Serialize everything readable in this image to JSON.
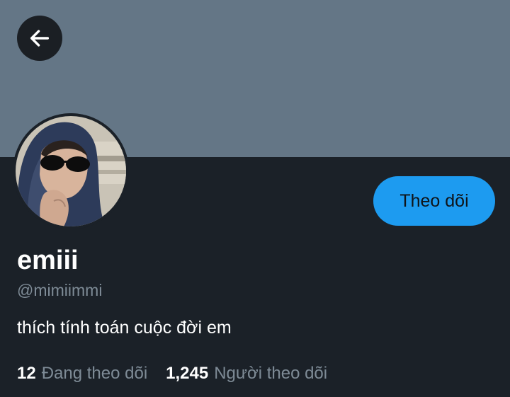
{
  "header": {
    "back_icon": "arrow-left-icon",
    "banner_color": "#647686"
  },
  "profile": {
    "display_name": "emiii",
    "handle": "@mimiimmi",
    "bio": "thích tính toán cuộc đời em",
    "follow_button_label": "Theo dõi",
    "accent_color": "#1d9bf0"
  },
  "stats": {
    "following_count": "12",
    "following_label": "Đang theo dõi",
    "followers_count": "1,245",
    "followers_label": "Người theo dõi"
  }
}
